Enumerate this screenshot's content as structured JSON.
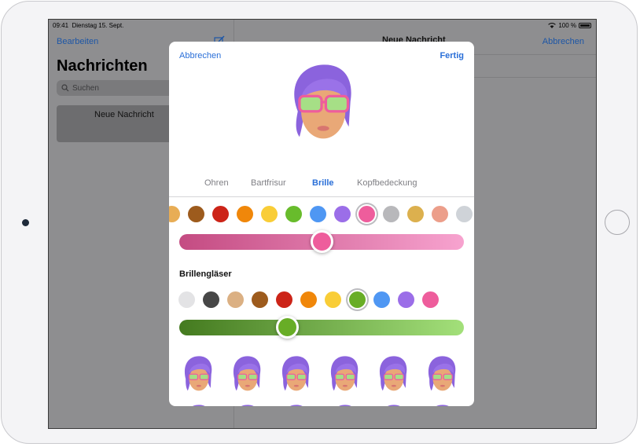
{
  "status": {
    "time": "09:41",
    "date": "Dienstag 15. Sept.",
    "battery": "100 %"
  },
  "sidebar": {
    "edit": "Bearbeiten",
    "title": "Nachrichten",
    "search_placeholder": "Suchen",
    "new_message": "Neue Nachricht"
  },
  "detail": {
    "title": "Neue Nachricht",
    "cancel": "Abbrechen"
  },
  "sheet": {
    "cancel": "Abbrechen",
    "done": "Fertig",
    "tabs": [
      {
        "label": "Ohren",
        "active": false
      },
      {
        "label": "Bartfrisur",
        "active": false
      },
      {
        "label": "Brille",
        "active": true
      },
      {
        "label": "Kopfbedeckung",
        "active": false
      }
    ],
    "frame_colors": [
      "#e8ad55",
      "#9d5b1d",
      "#cc2418",
      "#f0870a",
      "#f9cd37",
      "#68bc2c",
      "#4f97f3",
      "#9b6ee8",
      "#ee5d9c",
      "#b8b8bb",
      "#dcb04e",
      "#ec9e8a",
      "#cfd3d8"
    ],
    "frame_selected_index": 8,
    "frame_slider": {
      "from": "#c44b82",
      "to": "#f7a3cf",
      "value": 0.5,
      "knob": "#ee5d9c"
    },
    "lens_label": "Brillengläser",
    "lens_colors": [
      "#e3e3e5",
      "#474747",
      "#dbb083",
      "#9d5b1d",
      "#cc2418",
      "#f0870a",
      "#f9cd37",
      "#68ad26",
      "#4f97f3",
      "#9b6ee8",
      "#ee5d9c"
    ],
    "lens_selected_index": 7,
    "lens_slider": {
      "from": "#447a1f",
      "to": "#a3e07a",
      "value": 0.38,
      "knob": "#68ad26"
    },
    "preset_count": 6
  }
}
